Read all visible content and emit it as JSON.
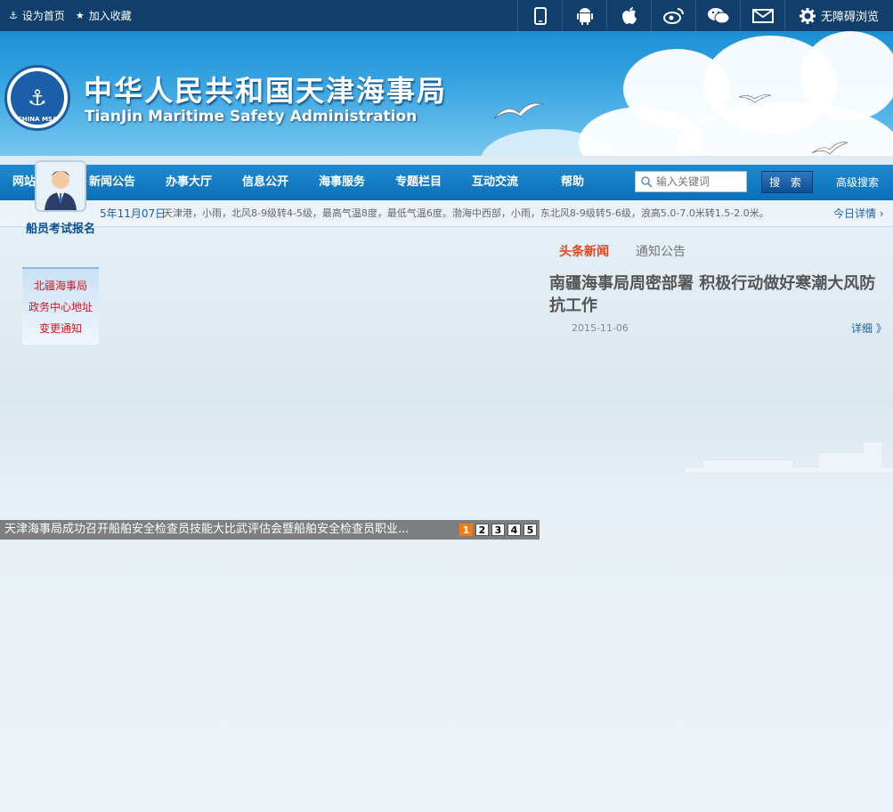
{
  "topbar": {
    "set_home": "设为首页",
    "add_favorite": "加入收藏",
    "accessibility": "无障碍浏览",
    "icons": [
      "mobile-icon",
      "android-icon",
      "apple-icon",
      "weibo-icon",
      "wechat-icon",
      "mail-icon",
      "gear-icon"
    ]
  },
  "banner": {
    "title_cn": "中华人民共和国天津海事局",
    "title_en": "TianJin Maritime Safety Administration",
    "emblem_text": "CHINA MSA"
  },
  "nav": {
    "items": [
      "网站首页",
      "新闻公告",
      "办事大厅",
      "信息公开",
      "海事服务",
      "专题栏目",
      "互动交流",
      "帮助"
    ],
    "search_placeholder": "输入关键词",
    "search_button": "搜 索",
    "advanced_search": "高级搜索"
  },
  "weather": {
    "date": "5年11月07日",
    "text": "天津港，小雨，北风8-9级转4-5级，最高气温8度，最低气温6度。渤海中西部，小雨，东北风8-9级转5-6级，浪高5.0-7.0米转1.5-2.0米。",
    "more": "今日详情 ›"
  },
  "side": {
    "exam_label": "船员考试报名",
    "notice_lines": [
      "北疆海事局",
      "政务中心地址",
      "变更通知"
    ]
  },
  "news": {
    "tabs": [
      "头条新闻",
      "通知公告"
    ],
    "headline": "南疆海事局周密部署 积极行动做好寒潮大风防抗工作",
    "date": "2015-11-06",
    "more": "详细 》"
  },
  "slideshow": {
    "caption": "天津海事局成功召开船舶安全检查员技能大比武评估会暨船舶安全检查员职业...",
    "pages": [
      "1",
      "2",
      "3",
      "4",
      "5"
    ],
    "current": "1"
  }
}
